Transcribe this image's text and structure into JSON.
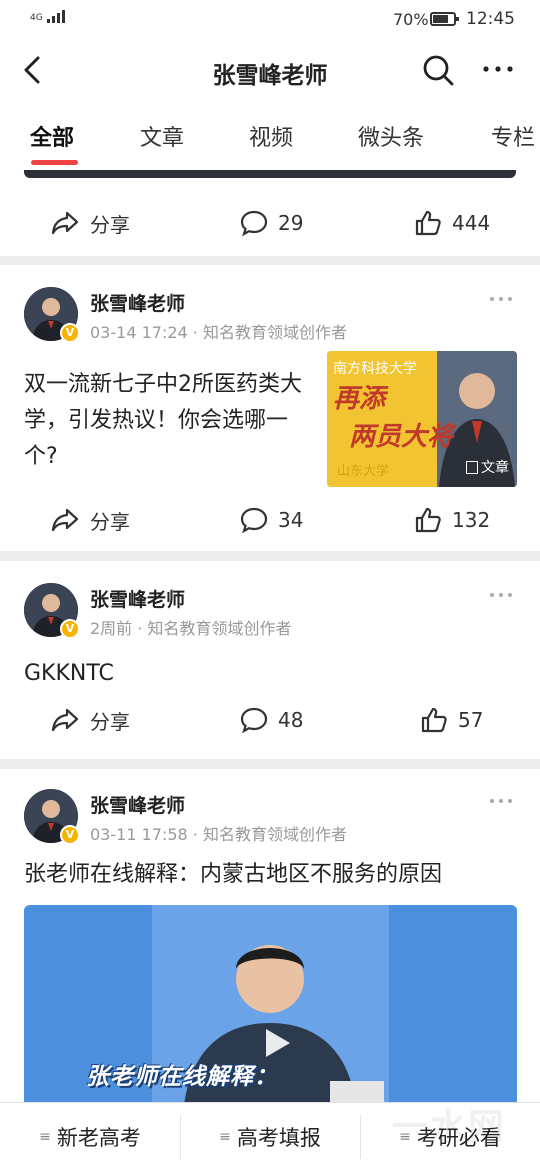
{
  "status_bar": {
    "network": "4G",
    "battery_pct": "70%",
    "time": "12:45",
    "signal_icon": "signal-icon",
    "battery_icon": "battery-icon"
  },
  "nav": {
    "title": "张雪峰老师",
    "back_icon": "back-arrow-icon",
    "search_icon": "search-icon",
    "more_icon": "more-horizontal-icon"
  },
  "tabs": [
    {
      "label": "全部",
      "active": true
    },
    {
      "label": "文章"
    },
    {
      "label": "视频"
    },
    {
      "label": "微头条"
    },
    {
      "label": "专栏"
    }
  ],
  "accent_color": "#e44444",
  "posts": [
    {
      "actions": {
        "share": "分享",
        "comments": "29",
        "likes": "444"
      }
    },
    {
      "author": "张雪峰老师",
      "meta": "03-14 17:24 · 知名教育领域创作者",
      "text": "双一流新七子中2所医药类大学，引发热议！你会选哪一个?",
      "thumb_tag": "文章",
      "actions": {
        "share": "分享",
        "comments": "34",
        "likes": "132"
      }
    },
    {
      "author": "张雪峰老师",
      "meta": "2周前 · 知名教育领域创作者",
      "text": "GKKNTC",
      "actions": {
        "share": "分享",
        "comments": "48",
        "likes": "57"
      }
    },
    {
      "author": "张雪峰老师",
      "meta": "03-11 17:58 · 知名教育领域创作者",
      "text": "张老师在线解释：内蒙古地区不服务的原因",
      "video_caption": "张老师在线解释："
    }
  ],
  "bottom_bar": [
    {
      "label": "新老高考"
    },
    {
      "label": "高考填报"
    },
    {
      "label": "考研必看"
    }
  ]
}
